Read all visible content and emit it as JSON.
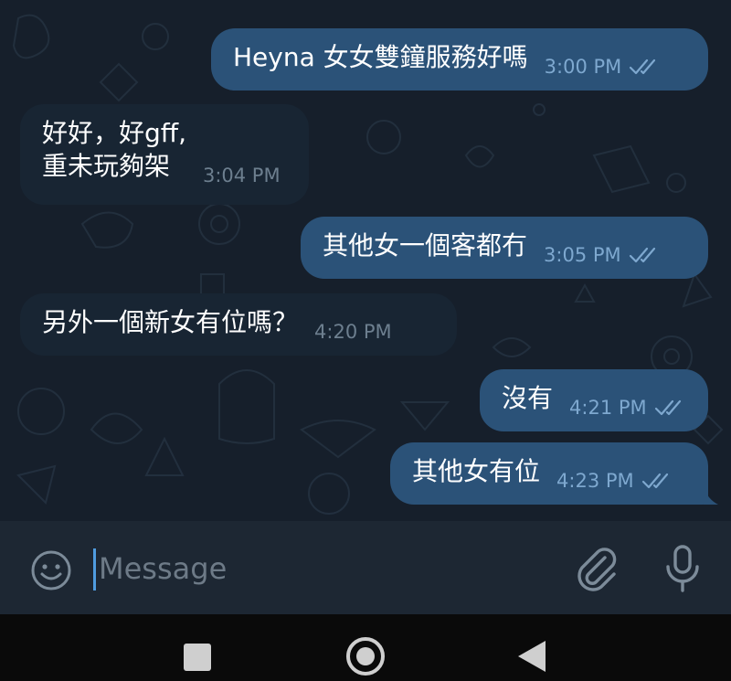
{
  "chat": {
    "messages": [
      {
        "direction": "out",
        "text": "Heyna 女女雙鐘服務好嗎",
        "time": "3:00 PM",
        "status": "read"
      },
      {
        "direction": "in",
        "text": "好好，好gff,\n重未玩夠架",
        "time": "3:04 PM"
      },
      {
        "direction": "out",
        "text": "其他女一個客都冇",
        "time": "3:05 PM",
        "status": "read"
      },
      {
        "direction": "in",
        "text": "另外一個新女有位嗎？",
        "time": "4:20 PM"
      },
      {
        "direction": "out",
        "text": "沒有",
        "time": "4:21 PM",
        "status": "read"
      },
      {
        "direction": "out",
        "text": "其他女有位",
        "time": "4:23 PM",
        "status": "read"
      }
    ]
  },
  "composer": {
    "placeholder": "Message",
    "emoji_icon": "emoji-icon",
    "attach_icon": "paperclip-icon",
    "mic_icon": "microphone-icon"
  },
  "navigation": {
    "recents_icon": "square-icon",
    "home_icon": "circle-icon",
    "back_icon": "triangle-back-icon"
  },
  "colors": {
    "chat_background": "#161f2b",
    "outgoing_bubble": "#2b5278",
    "incoming_bubble": "#182533",
    "composer_background": "#1d2733",
    "accent": "#4f9ce0"
  }
}
